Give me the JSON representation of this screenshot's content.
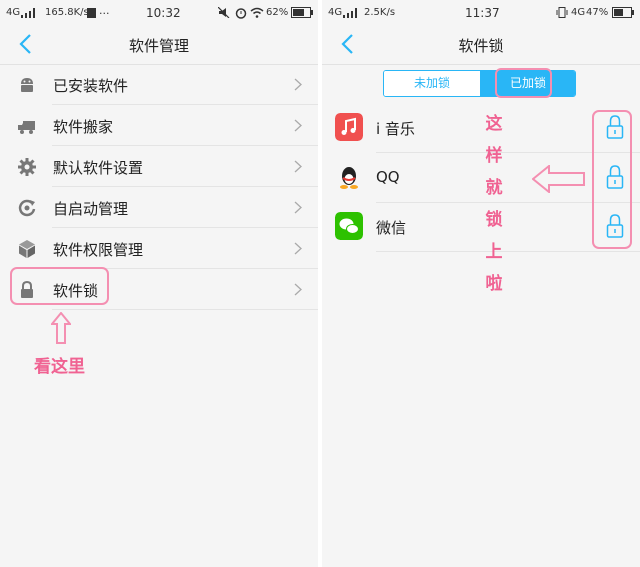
{
  "left": {
    "status": {
      "network": "4G",
      "speed": "165.8K/s",
      "dots": "···",
      "time": "10:32",
      "battery": "62%"
    },
    "title": "软件管理",
    "items": [
      {
        "label": "已安装软件",
        "icon": "android-icon"
      },
      {
        "label": "软件搬家",
        "icon": "truck-icon"
      },
      {
        "label": "默认软件设置",
        "icon": "gear-icon"
      },
      {
        "label": "自启动管理",
        "icon": "power-cycle-icon"
      },
      {
        "label": "软件权限管理",
        "icon": "cube-icon"
      },
      {
        "label": "软件锁",
        "icon": "lock-icon"
      }
    ],
    "annotation": "看这里"
  },
  "right": {
    "status": {
      "network": "4G",
      "speed": "2.5K/s",
      "time": "11:37",
      "net2": "4G",
      "battery": "47%"
    },
    "title": "软件锁",
    "tabs": {
      "unlocked": "未加锁",
      "locked": "已加锁"
    },
    "apps": [
      {
        "name": "i 音乐",
        "icon": "music-app-icon"
      },
      {
        "name": "QQ",
        "icon": "qq-penguin-icon"
      },
      {
        "name": "微信",
        "icon": "wechat-icon"
      }
    ],
    "annotation": [
      "这",
      "样",
      "就",
      "锁",
      "上",
      "啦"
    ]
  },
  "colors": {
    "accent": "#29b6f6",
    "annotation": "#f06292",
    "annotation_border": "#f48fb1"
  }
}
